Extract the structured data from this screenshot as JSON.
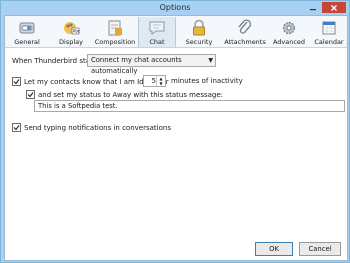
{
  "window": {
    "title": "Options"
  },
  "tabs": [
    {
      "label": "General",
      "icon": "gear-switch-icon"
    },
    {
      "label": "Display",
      "icon": "display-palette-icon"
    },
    {
      "label": "Composition",
      "icon": "composition-icon"
    },
    {
      "label": "Chat",
      "icon": "chat-bubble-icon",
      "selected": true
    },
    {
      "label": "Security",
      "icon": "lock-icon"
    },
    {
      "label": "Attachments",
      "icon": "paperclip-icon"
    },
    {
      "label": "Advanced",
      "icon": "gears-icon"
    },
    {
      "label": "Calendar",
      "icon": "calendar-icon"
    }
  ],
  "chat": {
    "starts_label": "When Thunderbird starts:",
    "starts_value": "Connect my chat accounts automatically",
    "idle_label": "Let my contacts know that I am Idle after",
    "idle_minutes": "5",
    "idle_suffix": "minutes of inactivity",
    "away_label": "and set my status to Away with this status message:",
    "away_message": "This is a Softpedia test.",
    "typing_label": "Send typing notifications in conversations"
  },
  "buttons": {
    "ok": "OK",
    "cancel": "Cancel"
  },
  "colors": {
    "accent": "#3c7fb1",
    "close": "#c7463a",
    "frame": "#a8d1f1"
  }
}
